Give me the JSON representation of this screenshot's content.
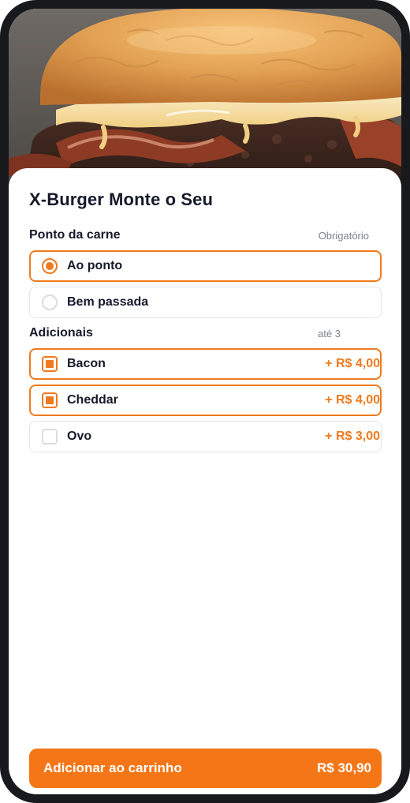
{
  "product": {
    "title": "X-Burger Monte o Seu",
    "image_icon": "burger-photo"
  },
  "meat_section": {
    "title": "Ponto da carne",
    "hint": "Obrigatório",
    "options": [
      {
        "label": "Ao ponto",
        "selected": true
      },
      {
        "label": "Bem passada",
        "selected": false
      }
    ]
  },
  "extras_section": {
    "title": "Adicionais",
    "hint": "até 3",
    "options": [
      {
        "label": "Bacon",
        "price": "+ R$ 4,00",
        "checked": true
      },
      {
        "label": "Cheddar",
        "price": "+ R$ 4,00",
        "checked": true
      },
      {
        "label": "Ovo",
        "price": "+ R$ 3,00",
        "checked": false
      }
    ]
  },
  "cart": {
    "label": "Adicionar ao carrinho",
    "total": "R$ 30,90"
  },
  "colors": {
    "accent": "#f07a1d",
    "button": "#f47617",
    "text": "#151a2b",
    "hint": "#7c818c",
    "border": "#e3e5ea",
    "frame": "#17191d"
  }
}
